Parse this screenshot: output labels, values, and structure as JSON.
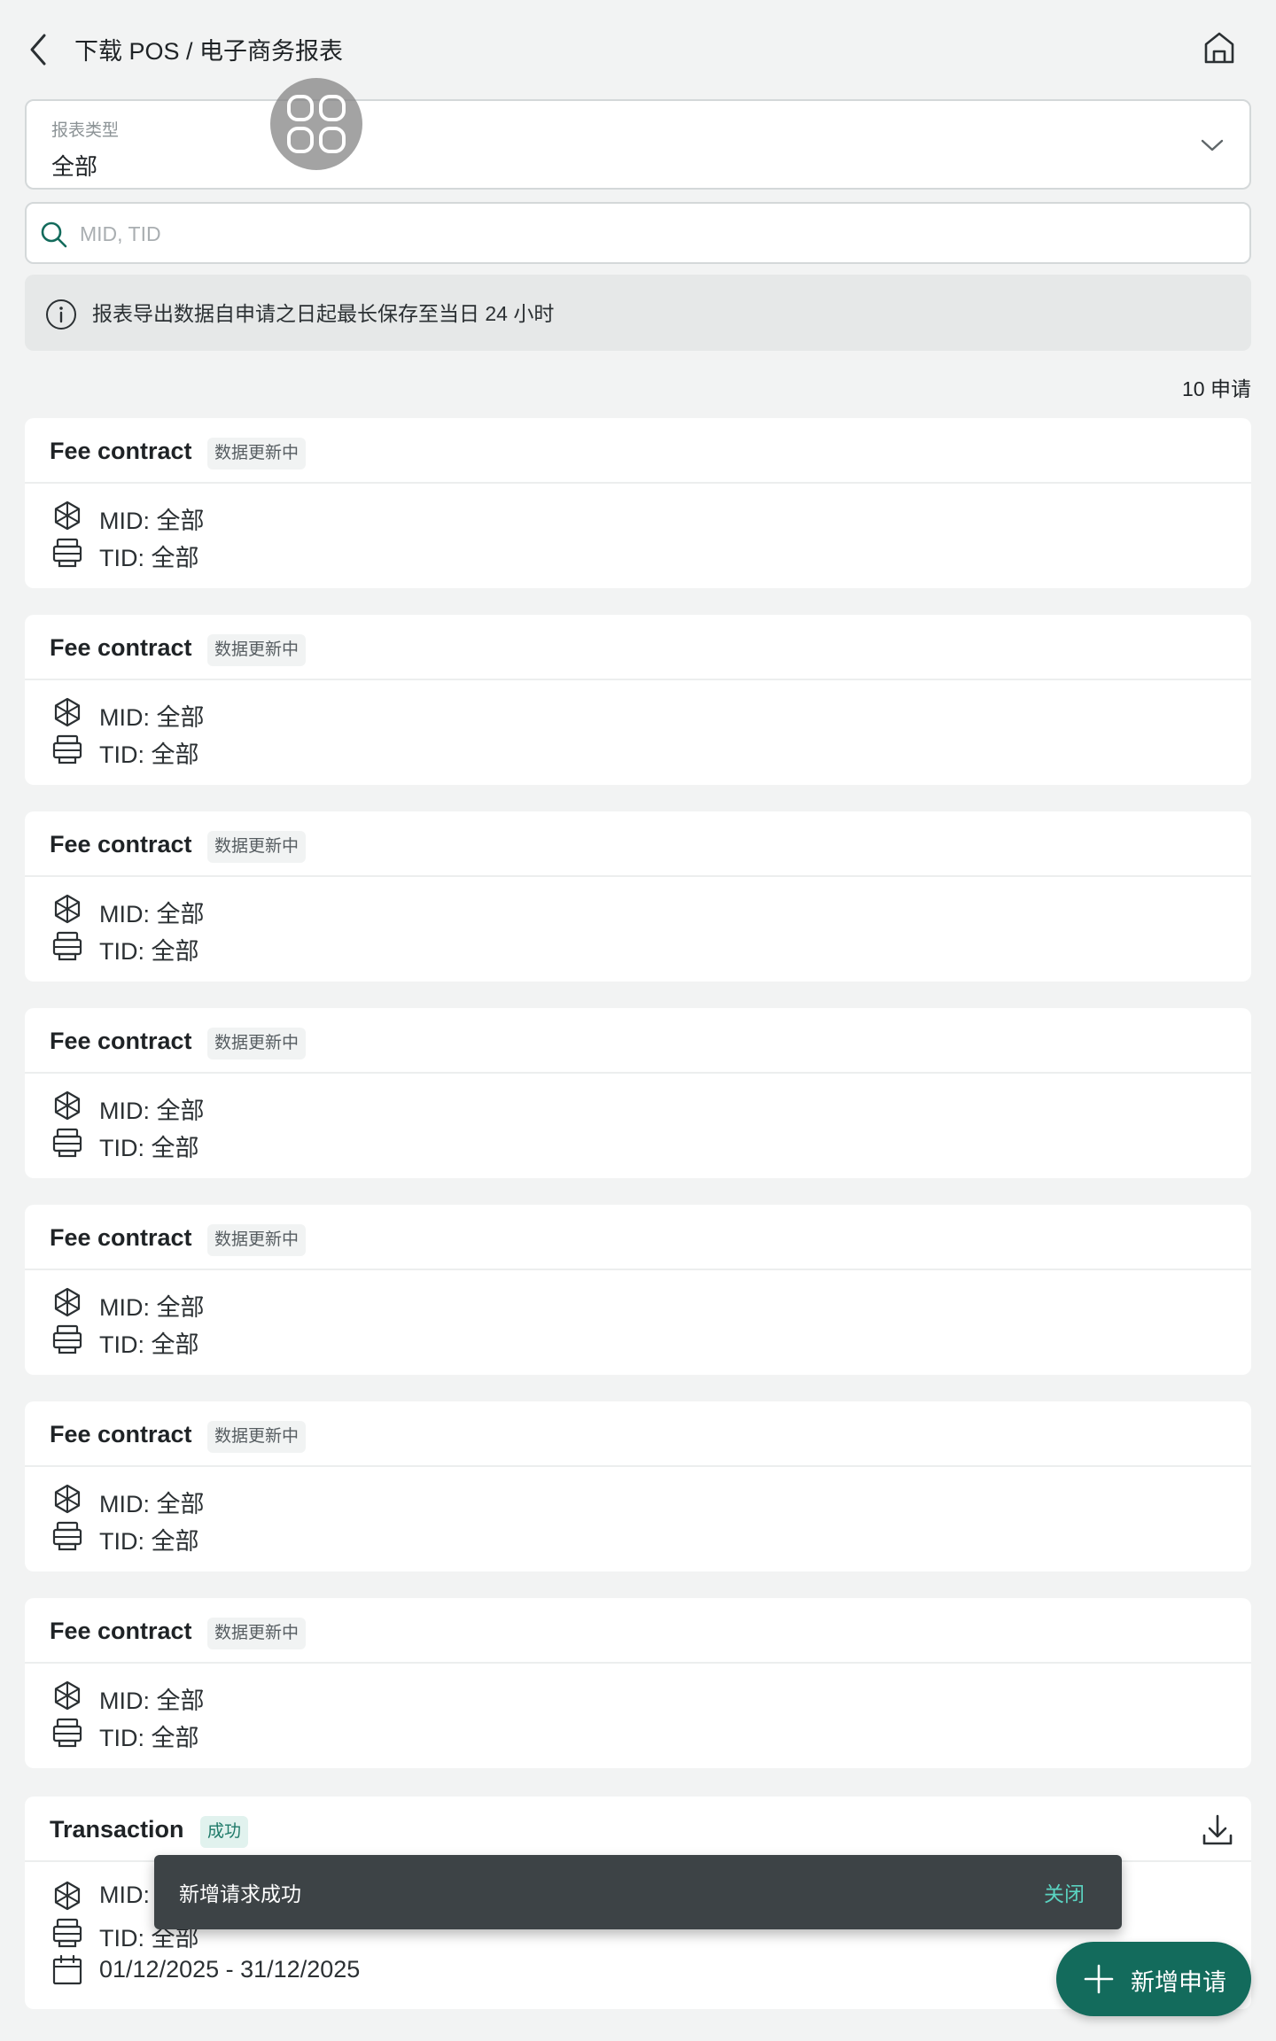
{
  "header": {
    "title": "下载 POS / 电子商务报表"
  },
  "filter": {
    "label": "报表类型",
    "value": "全部"
  },
  "search": {
    "placeholder": "MID, TID"
  },
  "notice": {
    "text": "报表导出数据自申请之日起最长保存至当日 24 小时"
  },
  "count_text": "10 申请",
  "cards": [
    {
      "title": "Fee contract",
      "status": "数据更新中",
      "mid": "MID: 全部",
      "tid": "TID:  全部"
    },
    {
      "title": "Fee contract",
      "status": "数据更新中",
      "mid": "MID: 全部",
      "tid": "TID:  全部"
    },
    {
      "title": "Fee contract",
      "status": "数据更新中",
      "mid": "MID: 全部",
      "tid": "TID:  全部"
    },
    {
      "title": "Fee contract",
      "status": "数据更新中",
      "mid": "MID: 全部",
      "tid": "TID:  全部"
    },
    {
      "title": "Fee contract",
      "status": "数据更新中",
      "mid": "MID: 全部",
      "tid": "TID:  全部"
    },
    {
      "title": "Fee contract",
      "status": "数据更新中",
      "mid": "MID: 全部",
      "tid": "TID:  全部"
    },
    {
      "title": "Fee contract",
      "status": "数据更新中",
      "mid": "MID: 全部",
      "tid": "TID:  全部"
    },
    {
      "title": "Transaction",
      "status": "成功",
      "mid": "MID:",
      "tid": "TID:  全部",
      "date": "01/12/2025 - 31/12/2025"
    }
  ],
  "snackbar": {
    "message": "新增请求成功",
    "action": "关闭"
  },
  "fab": {
    "label": "新增申请"
  },
  "colors": {
    "accent": "#136b5c",
    "background": "#f2f3f3",
    "snackbar": "#3d4346",
    "success_badge": "#e1f2ee"
  }
}
